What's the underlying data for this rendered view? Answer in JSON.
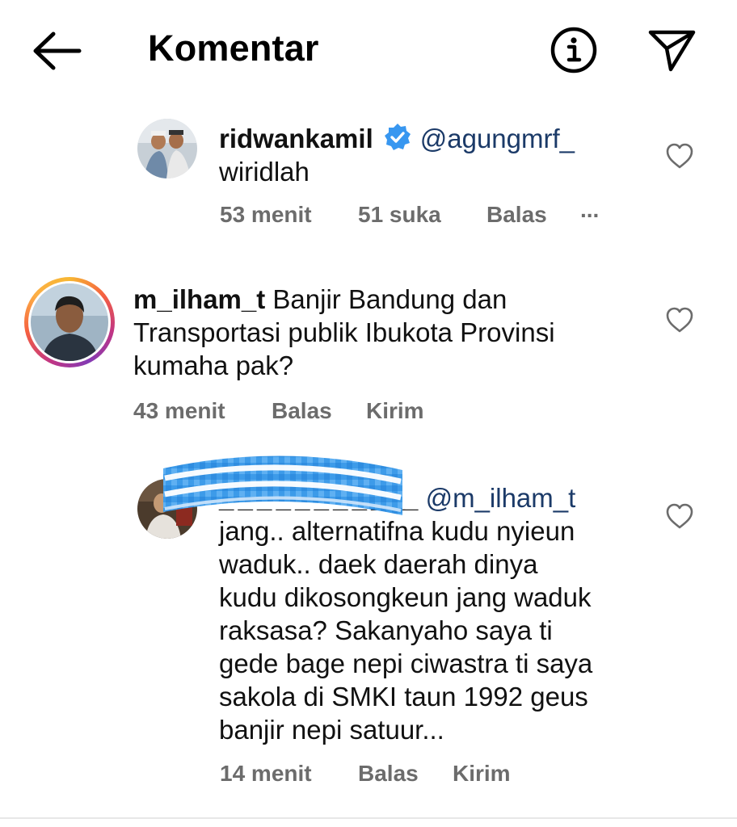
{
  "header": {
    "title": "Komentar",
    "icons": [
      "back-arrow-icon",
      "info-icon",
      "send-icon"
    ]
  },
  "comments": [
    {
      "username": "ridwankamil",
      "verified": true,
      "mention": "@agungmrf_",
      "text": "wiridlah",
      "time": "53 menit",
      "likes": "51 suka",
      "reply": "Balas",
      "more": "..."
    },
    {
      "username": "m_ilham_t",
      "text_line1": "Banjir Bandung dan",
      "text_line2": "Transportasi publik Ibukota Provinsi",
      "text_line3": "kumaha pak?",
      "time": "43 menit",
      "reply": "Balas",
      "send": "Kirim"
    },
    {
      "username_visible": "_ _ _ _ _ _ _ _ _ _",
      "username_tail": "_",
      "mention": "@m_ilham_t",
      "lines": [
        "jang.. alternatifna kudu nyieun",
        "waduk.. daek daerah dinya",
        "kudu dikosongkeun jang waduk",
        "raksasa? Sakanyaho saya ti",
        "gede bage nepi ciwastra ti saya",
        "sakola di SMKI taun 1992 geus",
        "banjir nepi satuur..."
      ],
      "time": "14 menit",
      "reply": "Balas",
      "send": "Kirim"
    }
  ],
  "colors": {
    "meta_text": "#6c6c6c",
    "mention": "#1b3a68",
    "verified_badge": "#3897f0",
    "blur_overlay": "#3d9be9"
  }
}
